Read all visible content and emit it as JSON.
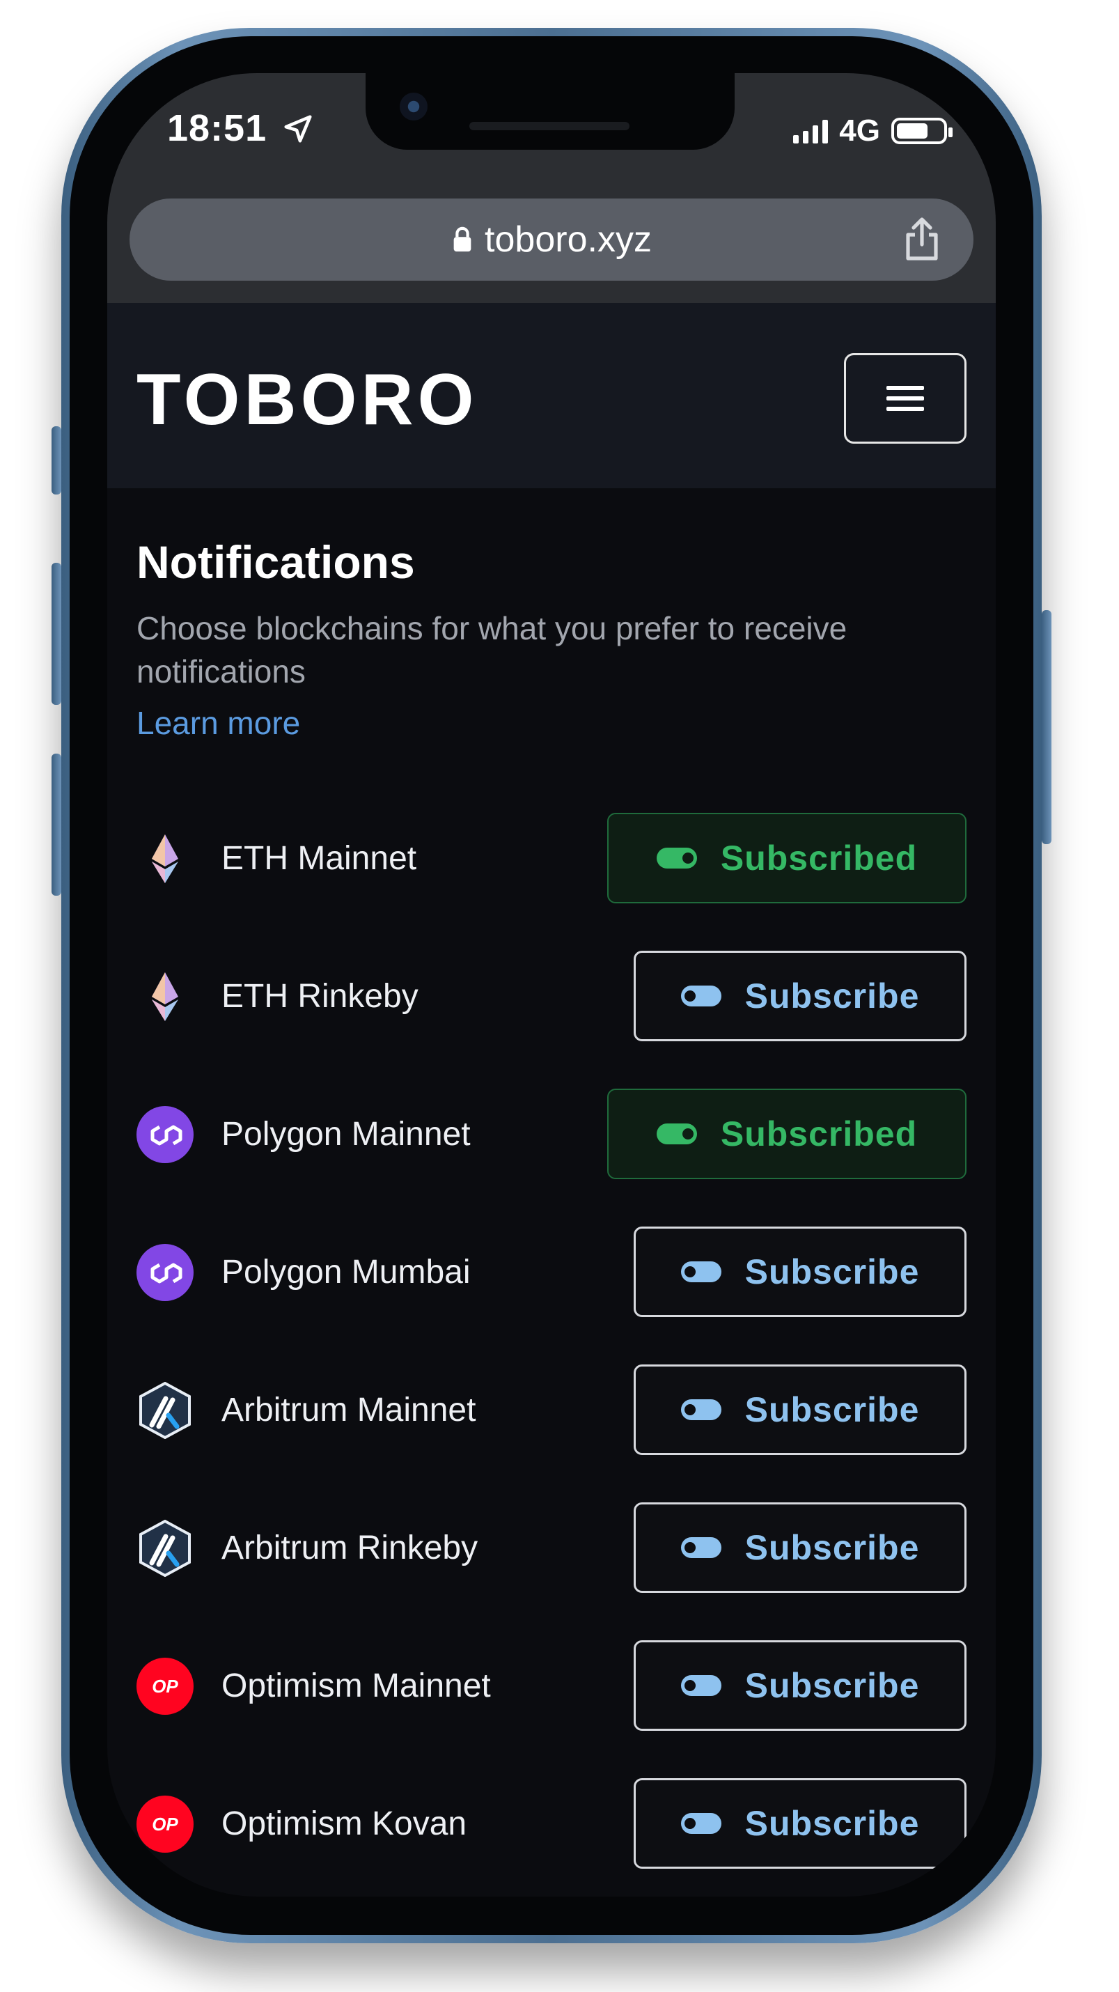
{
  "status_bar": {
    "time": "18:51",
    "network": "4G"
  },
  "browser": {
    "url": "toboro.xyz"
  },
  "site": {
    "logo": "TOBORO"
  },
  "notifications": {
    "title": "Notifications",
    "subtitle": "Choose blockchains for what you prefer to receive notifications",
    "learn_more": "Learn more"
  },
  "chains": [
    {
      "name": "ETH Mainnet",
      "icon": "ethereum-icon",
      "button": "Subscribed",
      "subscribed": true
    },
    {
      "name": "ETH Rinkeby",
      "icon": "ethereum-icon",
      "button": "Subscribe",
      "subscribed": false
    },
    {
      "name": "Polygon Mainnet",
      "icon": "polygon-icon",
      "button": "Subscribed",
      "subscribed": true
    },
    {
      "name": "Polygon Mumbai",
      "icon": "polygon-icon",
      "button": "Subscribe",
      "subscribed": false
    },
    {
      "name": "Arbitrum Mainnet",
      "icon": "arbitrum-icon",
      "button": "Subscribe",
      "subscribed": false
    },
    {
      "name": "Arbitrum Rinkeby",
      "icon": "arbitrum-icon",
      "button": "Subscribe",
      "subscribed": false
    },
    {
      "name": "Optimism Mainnet",
      "icon": "optimism-icon",
      "icon_text": "OP",
      "button": "Subscribe",
      "subscribed": false
    },
    {
      "name": "Optimism Kovan",
      "icon": "optimism-icon",
      "icon_text": "OP",
      "button": "Subscribe",
      "subscribed": false
    }
  ],
  "colors": {
    "subscribed": "#35b865",
    "subscribe": "#8ec2ef",
    "link": "#5b9be0",
    "polygon": "#8247e5",
    "optimism": "#ff0420"
  }
}
